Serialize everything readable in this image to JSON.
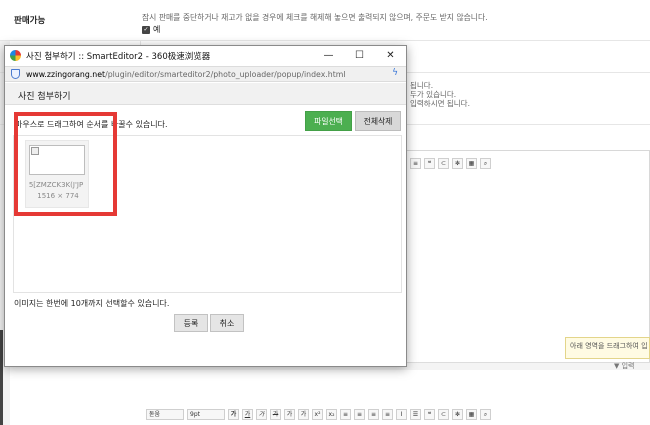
{
  "background": {
    "sale_label": "판매가능",
    "sale_description": "잠시 판매를 중단하거나 재고가 없을 경우에 체크를 해제해 놓으면 출력되지 않으며, 주문도 받지 않습니다.",
    "sale_check_label": "예",
    "side_text_1": "됩니다.",
    "side_text_2": "두가 있습니다.",
    "side_text_3": "입력하시면 됩니다.",
    "toolbar_font": "돋움",
    "toolbar_size": "9pt",
    "tooltip_text": "아래 영역을 드래그하여 입",
    "input_hint": "▼ 입력"
  },
  "popup": {
    "window_title": "사진 첨부하기 :: SmartEditor2 - 360极速浏览器",
    "url_host": "www.zzingorang.net",
    "url_path": "/plugin/editor/smarteditor2/photo_uploader/popup/index.html",
    "header_title": "사진 첨부하기",
    "instruction": "마우스로 드래그하여 순서를 바꿀수 있습니다.",
    "select_files_button": "파일선택",
    "delete_all_button": "전체삭제",
    "thumbnail_name": "5[ZMZCK3K(J'JP",
    "thumbnail_size": "1516 × 774",
    "limit_text": "이미지는 한번에 10개까지 선택할수 있습니다.",
    "register_button": "등록",
    "cancel_button": "취소",
    "minimize_glyph": "—",
    "maximize_glyph": "☐",
    "close_glyph": "✕"
  },
  "colors": {
    "green_button": "#4caf50",
    "highlight_red": "#e53935"
  }
}
